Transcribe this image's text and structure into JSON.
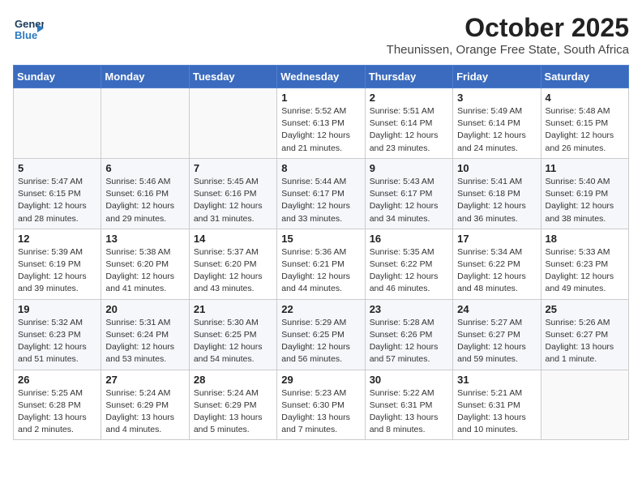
{
  "logo": {
    "line1": "General",
    "line2": "Blue",
    "arrow": "▶"
  },
  "title": "October 2025",
  "subtitle": "Theunissen, Orange Free State, South Africa",
  "weekdays": [
    "Sunday",
    "Monday",
    "Tuesday",
    "Wednesday",
    "Thursday",
    "Friday",
    "Saturday"
  ],
  "weeks": [
    [
      {
        "day": "",
        "info": ""
      },
      {
        "day": "",
        "info": ""
      },
      {
        "day": "",
        "info": ""
      },
      {
        "day": "1",
        "info": "Sunrise: 5:52 AM\nSunset: 6:13 PM\nDaylight: 12 hours\nand 21 minutes."
      },
      {
        "day": "2",
        "info": "Sunrise: 5:51 AM\nSunset: 6:14 PM\nDaylight: 12 hours\nand 23 minutes."
      },
      {
        "day": "3",
        "info": "Sunrise: 5:49 AM\nSunset: 6:14 PM\nDaylight: 12 hours\nand 24 minutes."
      },
      {
        "day": "4",
        "info": "Sunrise: 5:48 AM\nSunset: 6:15 PM\nDaylight: 12 hours\nand 26 minutes."
      }
    ],
    [
      {
        "day": "5",
        "info": "Sunrise: 5:47 AM\nSunset: 6:15 PM\nDaylight: 12 hours\nand 28 minutes."
      },
      {
        "day": "6",
        "info": "Sunrise: 5:46 AM\nSunset: 6:16 PM\nDaylight: 12 hours\nand 29 minutes."
      },
      {
        "day": "7",
        "info": "Sunrise: 5:45 AM\nSunset: 6:16 PM\nDaylight: 12 hours\nand 31 minutes."
      },
      {
        "day": "8",
        "info": "Sunrise: 5:44 AM\nSunset: 6:17 PM\nDaylight: 12 hours\nand 33 minutes."
      },
      {
        "day": "9",
        "info": "Sunrise: 5:43 AM\nSunset: 6:17 PM\nDaylight: 12 hours\nand 34 minutes."
      },
      {
        "day": "10",
        "info": "Sunrise: 5:41 AM\nSunset: 6:18 PM\nDaylight: 12 hours\nand 36 minutes."
      },
      {
        "day": "11",
        "info": "Sunrise: 5:40 AM\nSunset: 6:19 PM\nDaylight: 12 hours\nand 38 minutes."
      }
    ],
    [
      {
        "day": "12",
        "info": "Sunrise: 5:39 AM\nSunset: 6:19 PM\nDaylight: 12 hours\nand 39 minutes."
      },
      {
        "day": "13",
        "info": "Sunrise: 5:38 AM\nSunset: 6:20 PM\nDaylight: 12 hours\nand 41 minutes."
      },
      {
        "day": "14",
        "info": "Sunrise: 5:37 AM\nSunset: 6:20 PM\nDaylight: 12 hours\nand 43 minutes."
      },
      {
        "day": "15",
        "info": "Sunrise: 5:36 AM\nSunset: 6:21 PM\nDaylight: 12 hours\nand 44 minutes."
      },
      {
        "day": "16",
        "info": "Sunrise: 5:35 AM\nSunset: 6:22 PM\nDaylight: 12 hours\nand 46 minutes."
      },
      {
        "day": "17",
        "info": "Sunrise: 5:34 AM\nSunset: 6:22 PM\nDaylight: 12 hours\nand 48 minutes."
      },
      {
        "day": "18",
        "info": "Sunrise: 5:33 AM\nSunset: 6:23 PM\nDaylight: 12 hours\nand 49 minutes."
      }
    ],
    [
      {
        "day": "19",
        "info": "Sunrise: 5:32 AM\nSunset: 6:23 PM\nDaylight: 12 hours\nand 51 minutes."
      },
      {
        "day": "20",
        "info": "Sunrise: 5:31 AM\nSunset: 6:24 PM\nDaylight: 12 hours\nand 53 minutes."
      },
      {
        "day": "21",
        "info": "Sunrise: 5:30 AM\nSunset: 6:25 PM\nDaylight: 12 hours\nand 54 minutes."
      },
      {
        "day": "22",
        "info": "Sunrise: 5:29 AM\nSunset: 6:25 PM\nDaylight: 12 hours\nand 56 minutes."
      },
      {
        "day": "23",
        "info": "Sunrise: 5:28 AM\nSunset: 6:26 PM\nDaylight: 12 hours\nand 57 minutes."
      },
      {
        "day": "24",
        "info": "Sunrise: 5:27 AM\nSunset: 6:27 PM\nDaylight: 12 hours\nand 59 minutes."
      },
      {
        "day": "25",
        "info": "Sunrise: 5:26 AM\nSunset: 6:27 PM\nDaylight: 13 hours\nand 1 minute."
      }
    ],
    [
      {
        "day": "26",
        "info": "Sunrise: 5:25 AM\nSunset: 6:28 PM\nDaylight: 13 hours\nand 2 minutes."
      },
      {
        "day": "27",
        "info": "Sunrise: 5:24 AM\nSunset: 6:29 PM\nDaylight: 13 hours\nand 4 minutes."
      },
      {
        "day": "28",
        "info": "Sunrise: 5:24 AM\nSunset: 6:29 PM\nDaylight: 13 hours\nand 5 minutes."
      },
      {
        "day": "29",
        "info": "Sunrise: 5:23 AM\nSunset: 6:30 PM\nDaylight: 13 hours\nand 7 minutes."
      },
      {
        "day": "30",
        "info": "Sunrise: 5:22 AM\nSunset: 6:31 PM\nDaylight: 13 hours\nand 8 minutes."
      },
      {
        "day": "31",
        "info": "Sunrise: 5:21 AM\nSunset: 6:31 PM\nDaylight: 13 hours\nand 10 minutes."
      },
      {
        "day": "",
        "info": ""
      }
    ]
  ]
}
